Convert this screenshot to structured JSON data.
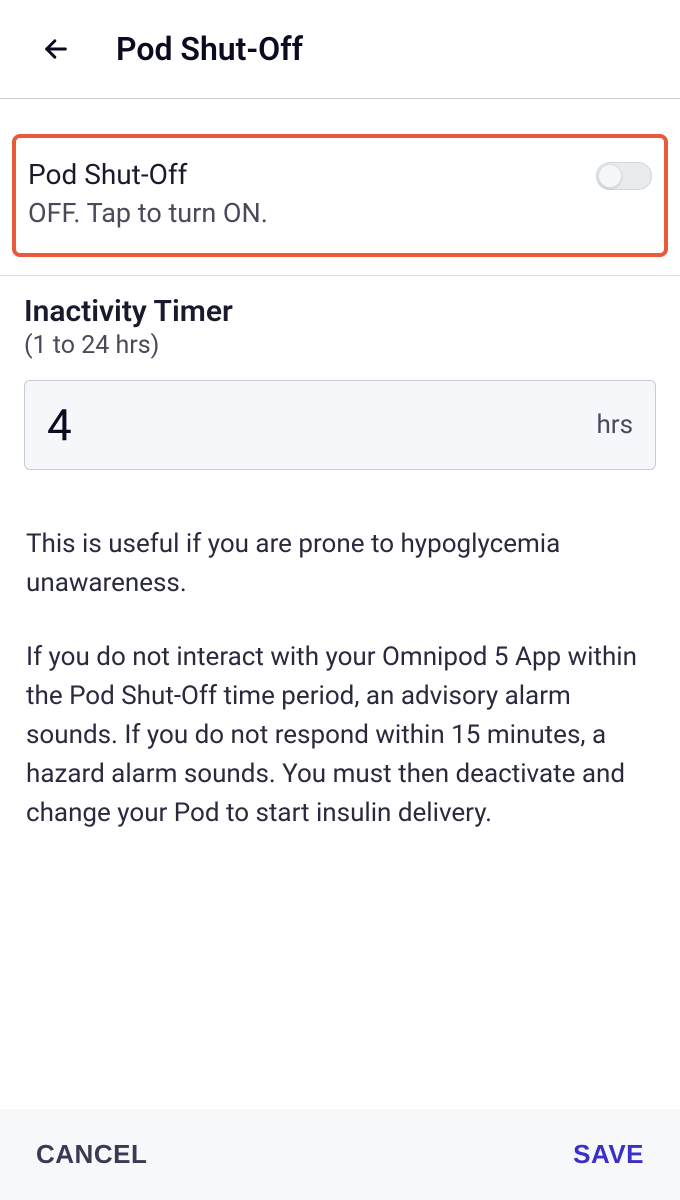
{
  "header": {
    "title": "Pod Shut-Off"
  },
  "toggle": {
    "title": "Pod Shut-Off",
    "subtitle": "OFF. Tap to turn ON.",
    "state": "off"
  },
  "timer": {
    "title": "Inactivity Timer",
    "range": "(1 to 24 hrs)",
    "value": "4",
    "unit": "hrs"
  },
  "body": {
    "para1": "This is useful if you are prone to hypoglycemia unawareness.",
    "para2": "If you do not interact with your Omnipod 5 App within the Pod Shut-Off time period, an advisory alarm sounds. If you do not respond within 15 minutes, a hazard alarm sounds. You must then deactivate and change your Pod to start insulin delivery."
  },
  "footer": {
    "cancel": "CANCEL",
    "save": "SAVE"
  }
}
